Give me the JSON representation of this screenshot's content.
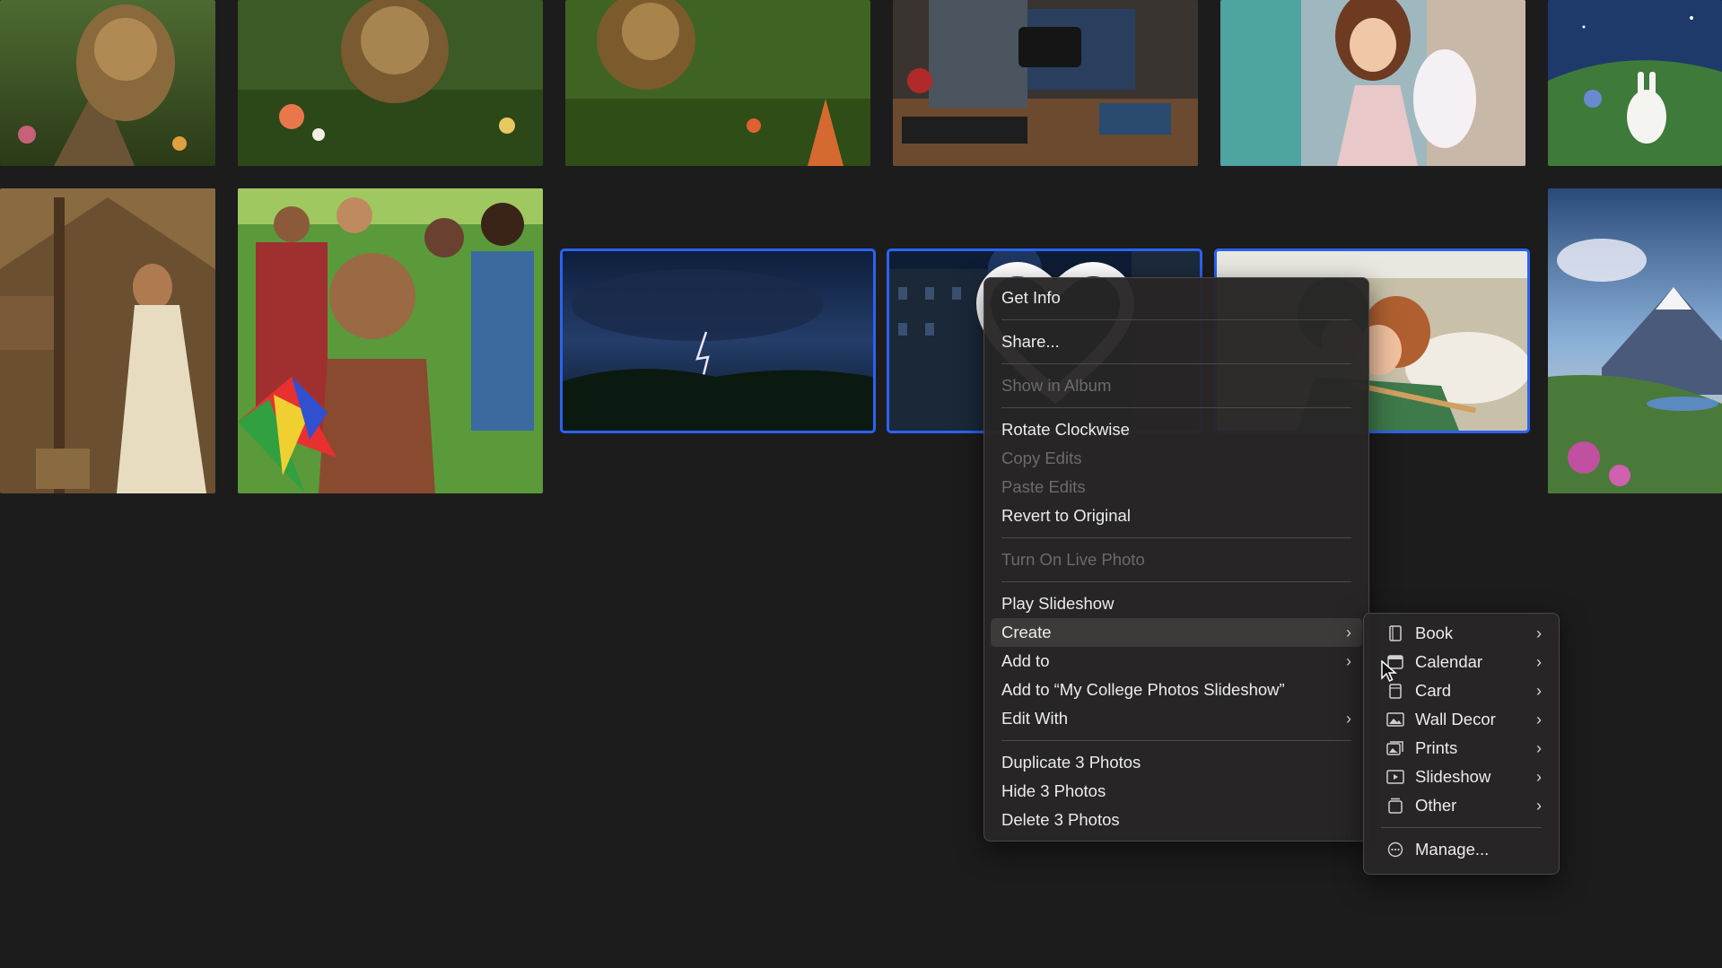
{
  "photos": {
    "row1": [
      "lion-forest-1",
      "lion-forest-2",
      "lion-forest-3",
      "soldier-phone",
      "girl-praying-angel",
      "rabbit-meadow"
    ],
    "row2": [
      "woman-praying-hut",
      "children-kite-field",
      "lightning-storm",
      "night-city-street",
      "sleeping-couple",
      "mountain-landscape"
    ],
    "selected_count": 3
  },
  "context_menu": {
    "get_info": "Get Info",
    "share": "Share...",
    "show_in_album": "Show in Album",
    "rotate_clockwise": "Rotate Clockwise",
    "copy_edits": "Copy Edits",
    "paste_edits": "Paste Edits",
    "revert_to_original": "Revert to Original",
    "turn_on_live_photo": "Turn On Live Photo",
    "play_slideshow": "Play Slideshow",
    "create": "Create",
    "add_to": "Add to",
    "add_to_slideshow": "Add to “My College Photos Slideshow”",
    "edit_with": "Edit With",
    "duplicate": "Duplicate 3 Photos",
    "hide": "Hide 3 Photos",
    "delete": "Delete 3 Photos"
  },
  "create_submenu": {
    "items": [
      {
        "label": "Book",
        "icon": "book-icon"
      },
      {
        "label": "Calendar",
        "icon": "calendar-icon"
      },
      {
        "label": "Card",
        "icon": "card-icon"
      },
      {
        "label": "Wall Decor",
        "icon": "wall-decor-icon"
      },
      {
        "label": "Prints",
        "icon": "prints-icon"
      },
      {
        "label": "Slideshow",
        "icon": "slideshow-icon"
      },
      {
        "label": "Other",
        "icon": "other-icon"
      }
    ],
    "manage": "Manage..."
  },
  "colors": {
    "background": "#1d1c1d",
    "selection": "#2a63f3",
    "menu_bg": "#282525",
    "disabled_text": "#6c6a6a"
  }
}
